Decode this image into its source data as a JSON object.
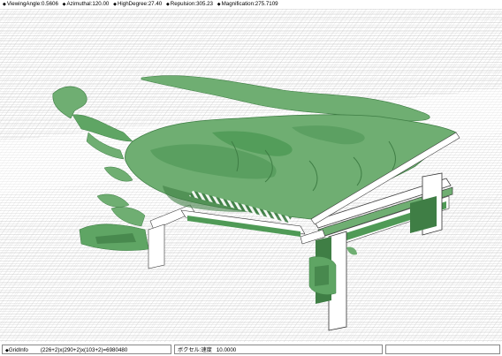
{
  "header": {
    "params": [
      {
        "label": "ViewingAngle",
        "value": "0.5606"
      },
      {
        "label": "Azimuthal",
        "value": "120.00"
      },
      {
        "label": "HighDegree",
        "value": "27.40"
      },
      {
        "label": "Repulsion",
        "value": "305.23"
      },
      {
        "label": "Magnification",
        "value": "275.7109"
      }
    ]
  },
  "status": {
    "grid_label": "GridInfo",
    "grid_value": "(226+2)x(290+2)x(103+2)=6980480",
    "voxel_label": "ボクセル:速度",
    "voxel_value": "10.0000",
    "extra": ""
  },
  "colors": {
    "surface": "#6fae72",
    "surface_shade": "#3f7e45",
    "grid": "#c8c8c8",
    "frame": "#ffffff"
  }
}
